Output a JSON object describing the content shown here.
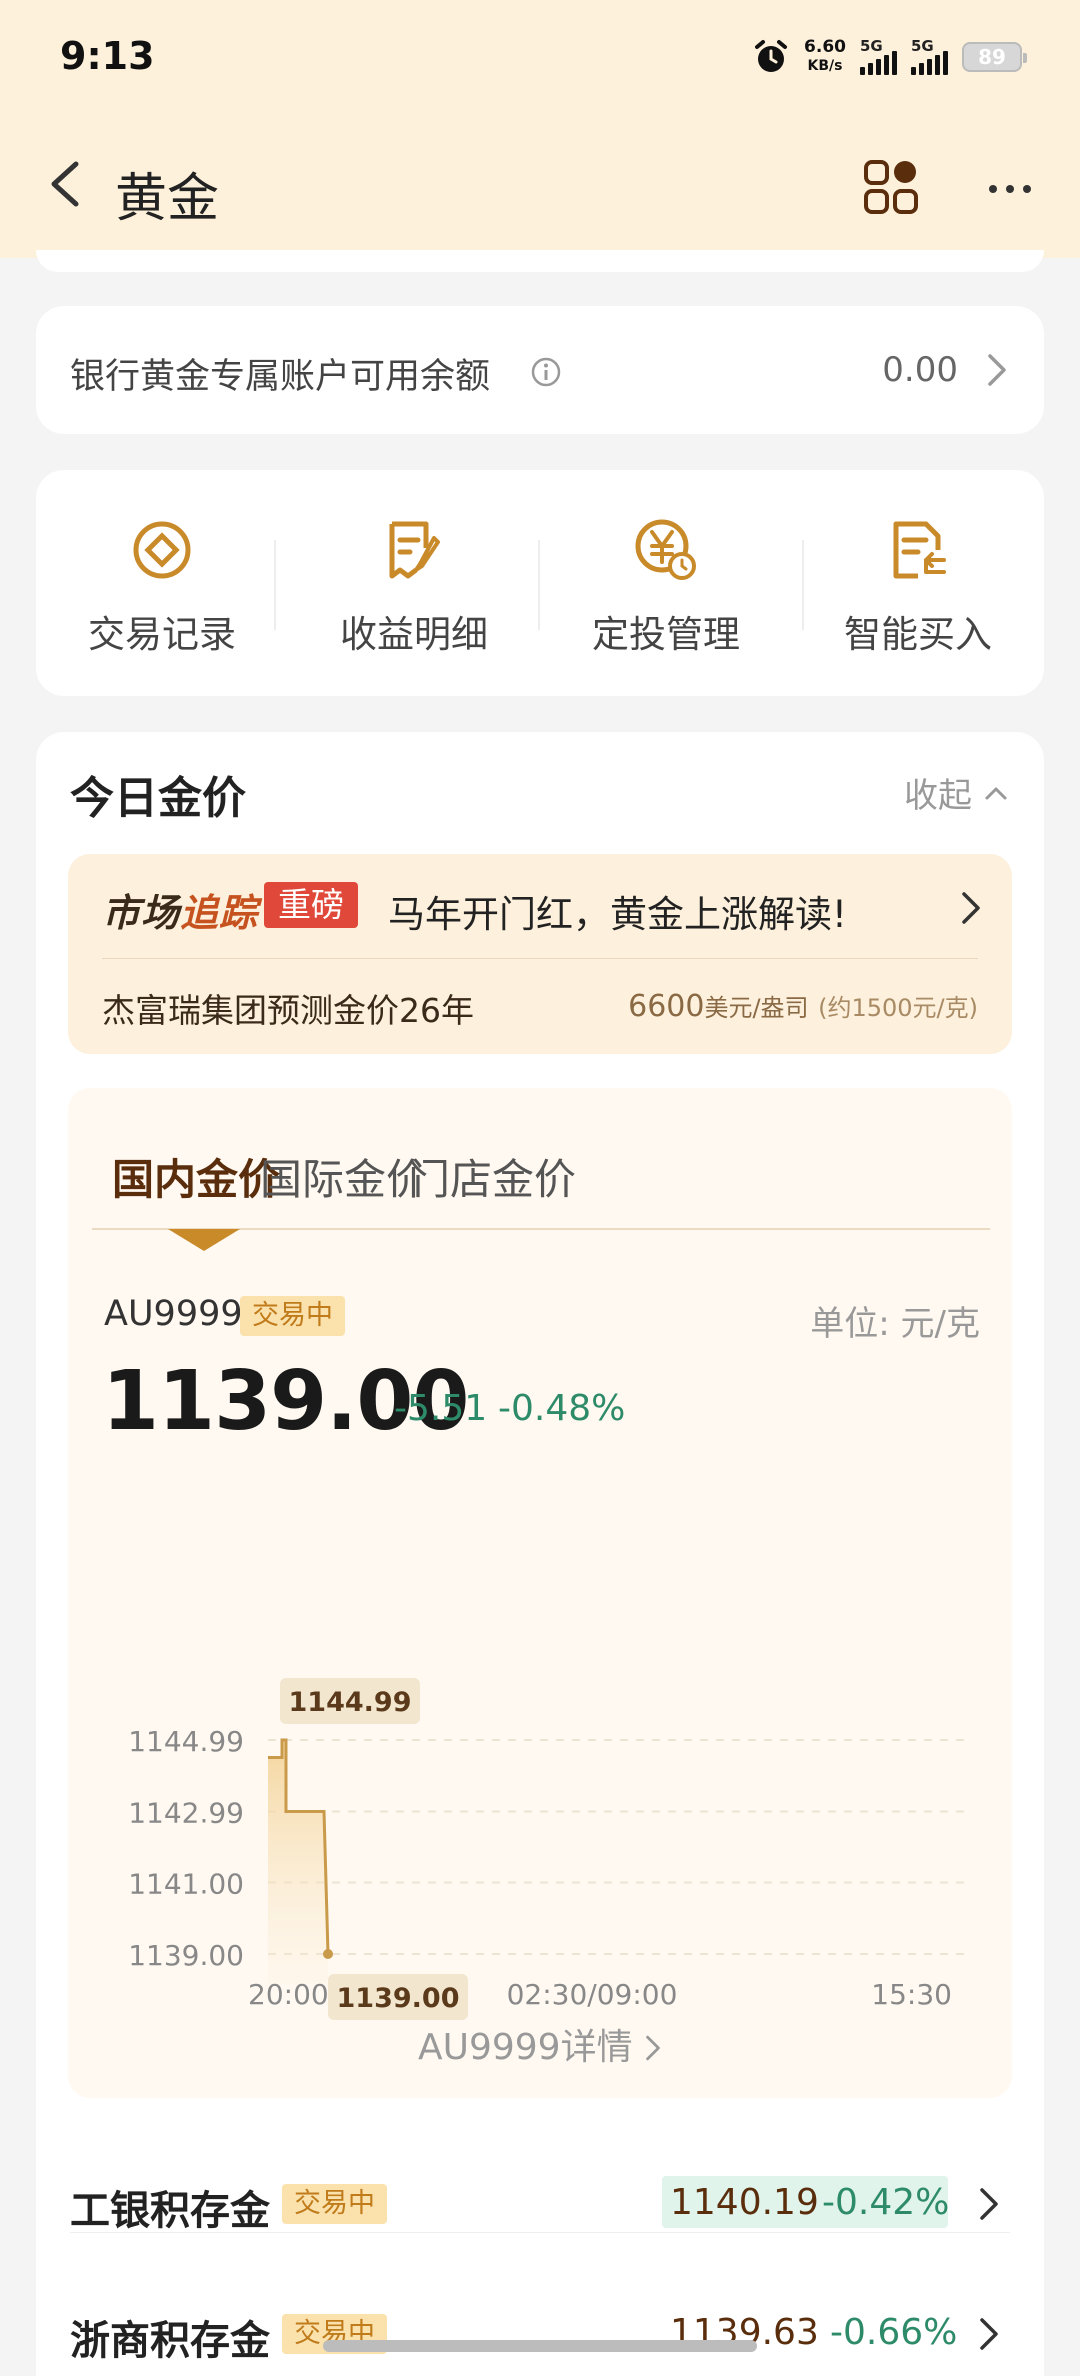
{
  "status_bar": {
    "time": "9:13",
    "net_speed": "6.60",
    "net_unit": "KB/s",
    "sim1": "5G",
    "sim2": "5G",
    "battery": "89"
  },
  "nav": {
    "title": "黄金"
  },
  "balance": {
    "label": "银行黄金专属账户可用余额",
    "value": "0.00"
  },
  "actions": [
    {
      "label": "交易记录",
      "icon": "coin-record-icon"
    },
    {
      "label": "收益明细",
      "icon": "edit-doc-icon"
    },
    {
      "label": "定投管理",
      "icon": "yuan-clock-icon"
    },
    {
      "label": "智能买入",
      "icon": "doc-return-icon"
    }
  ],
  "gold_section": {
    "title": "今日金价",
    "collapse": "收起",
    "market": {
      "logo_part1": "市场",
      "logo_part2": "追踪",
      "tag": "重磅",
      "headline": "马年开门红，黄金上涨解读!",
      "sub": "杰富瑞集团预测金价26年",
      "price_main": "6600",
      "price_unit": "美元/盎司",
      "price_note": "(约1500元/克)"
    },
    "tabs": [
      "国内金价",
      "国际金价",
      "门店金价"
    ],
    "active_tab": 0,
    "instrument": {
      "code": "AU9999",
      "status": "交易中",
      "unit_label": "单位: 元/克",
      "price": "1139.00",
      "change": "-5.51",
      "change_pct": "-0.48%"
    },
    "detail_link": "AU9999详情"
  },
  "chart_data": {
    "type": "line",
    "y_ticks": [
      "1144.99",
      "1142.99",
      "1141.00",
      "1139.00"
    ],
    "ylim": [
      1139.0,
      1144.99
    ],
    "x_ticks": [
      "20:00",
      "02:30/09:00",
      "15:30"
    ],
    "series": [
      {
        "values": [
          1144.5,
          1144.99,
          1143.5,
          1142.99,
          1142.99,
          1142.99,
          1139.0
        ]
      }
    ],
    "high_label": "1144.99",
    "low_label": "1139.00",
    "line_color": "#c99a4a",
    "grid": true
  },
  "products": [
    {
      "name": "工银积存金",
      "status": "交易中",
      "price": "1140.19",
      "change_pct": "-0.42%",
      "highlight": true
    },
    {
      "name": "浙商积存金",
      "status": "交易中",
      "price": "1139.63",
      "change_pct": "-0.66%",
      "highlight": false
    }
  ],
  "colors": {
    "header_bg": "#fdf1dc",
    "gold_accent": "#c98a2a",
    "down_green": "#2e8b6a",
    "tag_red": "#e0493a"
  }
}
